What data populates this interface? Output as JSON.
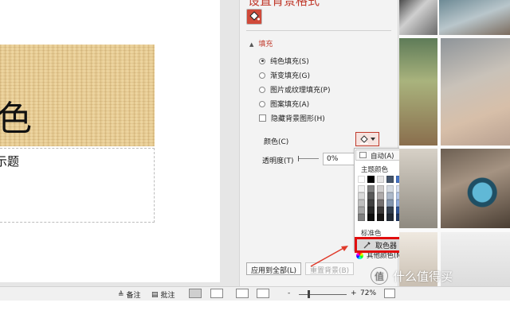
{
  "slide": {
    "big_char": "色",
    "subtitle": "示题"
  },
  "pane": {
    "title": "设置背景格式",
    "section": "填充",
    "options": [
      {
        "label": "纯色填充(S)",
        "checked": true
      },
      {
        "label": "渐变填充(G)",
        "checked": false
      },
      {
        "label": "图片或纹理填充(P)",
        "checked": false
      },
      {
        "label": "图案填充(A)",
        "checked": false
      }
    ],
    "hide_graphics": "隐藏背景图形(H)",
    "color_label": "颜色(C)",
    "transparency_label": "透明度(T)",
    "transparency_value": "0%",
    "apply_all": "应用到全部(L)",
    "reset": "重置背景(B)"
  },
  "dropdown": {
    "auto": "自动(A)",
    "theme_colors_label": "主题颜色",
    "standard_colors_label": "标准色",
    "more_colors": "其他颜色(M)...",
    "eyedropper": "取色器",
    "theme_columns": [
      [
        "#ffffff",
        "#f2f2f2",
        "#d9d9d9",
        "#bfbfbf",
        "#a6a6a6",
        "#808080"
      ],
      [
        "#000000",
        "#7f7f7f",
        "#595959",
        "#404040",
        "#262626",
        "#0d0d0d"
      ],
      [
        "#e7e6e6",
        "#d0cece",
        "#aeaaaa",
        "#757171",
        "#3a3838",
        "#171616"
      ],
      [
        "#44546a",
        "#d6dce4",
        "#adb9ca",
        "#8497b0",
        "#333f4f",
        "#222a35"
      ],
      [
        "#4472c4",
        "#d9e2f3",
        "#b4c6e7",
        "#8eaadb",
        "#2f5496",
        "#1f3864"
      ],
      [
        "#ed7d31",
        "#fbe5d5",
        "#f7cbac",
        "#f4b183",
        "#c55a11",
        "#833c0b"
      ],
      [
        "#a5a5a5",
        "#ededed",
        "#dbdbdb",
        "#c9c9c9",
        "#7b7b7b",
        "#525252"
      ],
      [
        "#ffc000",
        "#fff2cc",
        "#fee599",
        "#ffd965",
        "#bf9000",
        "#7f6000"
      ],
      [
        "#5b9bd5",
        "#deebf6",
        "#bdd7ee",
        "#9dc3e6",
        "#2e75b5",
        "#1e4e79"
      ],
      [
        "#70ad47",
        "#e2efd9",
        "#c5e0b3",
        "#a8d08d",
        "#538135",
        "#375623"
      ]
    ],
    "standard_colors": [
      "#c00000",
      "#ff0000",
      "#ffc000",
      "#ffff00",
      "#92d050",
      "#00b050",
      "#00b0f0",
      "#0070c0",
      "#002060",
      "#7030a0"
    ]
  },
  "statusbar": {
    "notes": "备注",
    "comments": "批注",
    "minus": "-",
    "plus": "+",
    "zoom": "72%"
  },
  "watermark": {
    "badge": "值",
    "text": "什么值得买"
  },
  "icons": {
    "paint_bucket": "paint-bucket-icon",
    "eyedropper": "eyedropper-icon",
    "notes": "notes-icon",
    "comments": "comment-icon"
  },
  "colors": {
    "accent_red": "#c0392b",
    "highlight_red": "#e10e0e"
  }
}
